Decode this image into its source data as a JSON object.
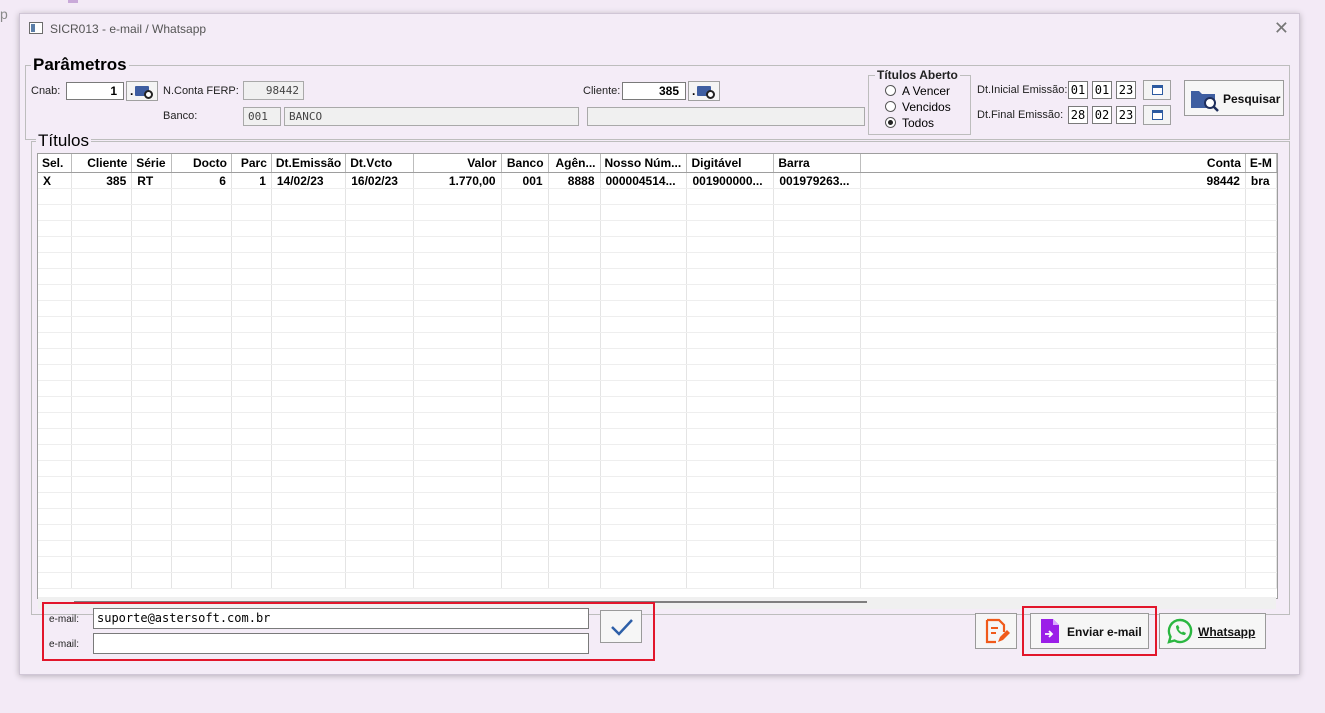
{
  "background": {
    "letter": "p"
  },
  "window": {
    "title": "SICR013 - e-mail / Whatsapp",
    "close_glyph": "✕"
  },
  "parametros": {
    "legend": "Parâmetros",
    "cnab_label": "Cnab:",
    "cnab_value": "1",
    "conta_label": "N.Conta FERP:",
    "conta_value": "98442",
    "banco_label": "Banco:",
    "banco_code": "001",
    "banco_name": "BANCO",
    "cliente_label": "Cliente:",
    "cliente_value": "385",
    "cliente_name": "",
    "lookup_text": "."
  },
  "titulos_aberto": {
    "legend": "Títulos Aberto",
    "options": [
      "A Vencer",
      "Vencidos",
      "Todos"
    ],
    "selected": "Todos"
  },
  "datas": {
    "inicial_label": "Dt.Inicial Emissão:",
    "inicial": [
      "01",
      "01",
      "23"
    ],
    "final_label": "Dt.Final Emissão:",
    "final": [
      "28",
      "02",
      "23"
    ]
  },
  "pesquisar_label": "Pesquisar",
  "titulos": {
    "legend": "Títulos",
    "columns": [
      "Sel.",
      "Cliente",
      "Série",
      "Docto",
      "Parc",
      "Dt.Emissão",
      "Dt.Vcto",
      "Valor",
      "Banco",
      "Agên...",
      "Nosso Núm...",
      "Digitável",
      "Barra",
      "Conta",
      "E-M"
    ],
    "rows": [
      [
        "X",
        "385",
        "RT",
        "6",
        "1",
        "14/02/23",
        "16/02/23",
        "1.770,00",
        "001",
        "8888",
        "000004514...",
        "001900000...",
        "001979263...",
        "98442",
        "bra"
      ]
    ]
  },
  "email": {
    "label1": "e-mail:",
    "value1": "suporte@astersoft.com.br",
    "label2": "e-mail:",
    "value2": ""
  },
  "buttons": {
    "enviar_email": "Enviar e-mail",
    "whatsapp": "Whatsapp"
  },
  "colors": {
    "highlight": "#e2162b",
    "accent": "#9b1fe8",
    "whatsapp": "#2bb741"
  }
}
